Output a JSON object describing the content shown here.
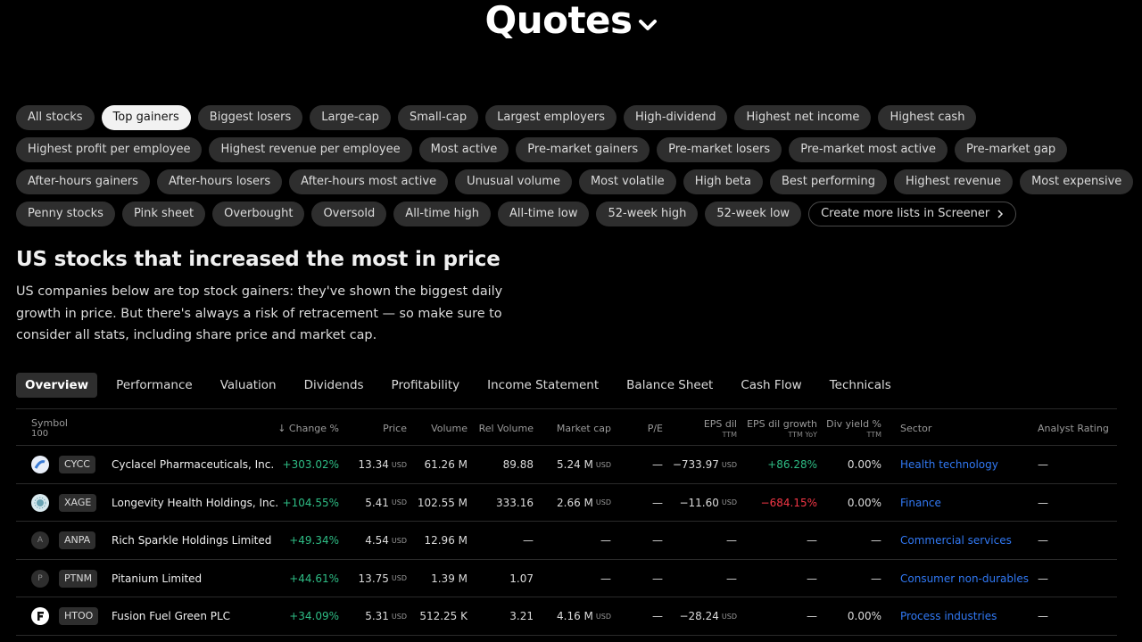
{
  "page": {
    "title": "Quotes",
    "heading": "US stocks that increased the most in price",
    "description": "US companies below are top stock gainers: they've shown the biggest daily growth in price. But there's always a risk of retracement — so make sure to consider all stats, including share price and market cap."
  },
  "lists": [
    [
      "All stocks",
      "Top gainers",
      "Biggest losers",
      "Large-cap",
      "Small-cap",
      "Largest employers",
      "High-dividend",
      "Highest net income",
      "Highest cash"
    ],
    [
      "Highest profit per employee",
      "Highest revenue per employee",
      "Most active",
      "Pre-market gainers",
      "Pre-market losers",
      "Pre-market most active",
      "Pre-market gap"
    ],
    [
      "After-hours gainers",
      "After-hours losers",
      "After-hours most active",
      "Unusual volume",
      "Most volatile",
      "High beta",
      "Best performing",
      "Highest revenue",
      "Most expensive"
    ],
    [
      "Penny stocks",
      "Pink sheet",
      "Overbought",
      "Oversold",
      "All-time high",
      "All-time low",
      "52-week high",
      "52-week low"
    ]
  ],
  "active_list": "Top gainers",
  "screener_link": "Create more lists in Screener",
  "tabs": [
    "Overview",
    "Performance",
    "Valuation",
    "Dividends",
    "Profitability",
    "Income Statement",
    "Balance Sheet",
    "Cash Flow",
    "Technicals"
  ],
  "active_tab": "Overview",
  "table": {
    "headers": {
      "symbol": "Symbol",
      "symbol_count": "100",
      "change": "↓ Change %",
      "price": "Price",
      "volume": "Volume",
      "rel_volume": "Rel Volume",
      "market_cap": "Market cap",
      "pe": "P/E",
      "eps": "EPS dil",
      "eps_sub": "TTM",
      "eps_growth": "EPS dil growth",
      "eps_growth_sub": "TTM YoY",
      "div_yield": "Div yield %",
      "div_yield_sub": "TTM",
      "sector": "Sector",
      "analyst": "Analyst Rating"
    },
    "currency": "USD",
    "rows": [
      {
        "logo": "cyclacel-logo-icon",
        "logo_letter": "",
        "ticker": "CYCC",
        "name": "Cyclacel Pharmaceuticals, Inc.",
        "change": "+303.02%",
        "price": "13.34",
        "volume": "61.26 M",
        "rel_volume": "89.88",
        "market_cap": "5.24 M",
        "pe": "—",
        "eps": "−733.97",
        "eps_growth": "+86.28%",
        "eps_growth_dir": "up",
        "div_yield": "0.00%",
        "sector": "Health technology",
        "analyst": "—"
      },
      {
        "logo": "longevity-logo-icon",
        "logo_letter": "",
        "ticker": "XAGE",
        "name": "Longevity Health Holdings, Inc.",
        "change": "+104.55%",
        "price": "5.41",
        "volume": "102.55 M",
        "rel_volume": "333.16",
        "market_cap": "2.66 M",
        "pe": "—",
        "eps": "−11.60",
        "eps_growth": "−684.15%",
        "eps_growth_dir": "down",
        "div_yield": "0.00%",
        "sector": "Finance",
        "analyst": "—"
      },
      {
        "logo": "letter-avatar-icon",
        "logo_letter": "A",
        "ticker": "ANPA",
        "name": "Rich Sparkle Holdings Limited",
        "change": "+49.34%",
        "price": "4.54",
        "volume": "12.96 M",
        "rel_volume": "—",
        "market_cap": "—",
        "pe": "—",
        "eps": "—",
        "eps_growth": "—",
        "eps_growth_dir": "none",
        "div_yield": "—",
        "sector": "Commercial services",
        "analyst": "—"
      },
      {
        "logo": "letter-avatar-icon",
        "logo_letter": "P",
        "ticker": "PTNM",
        "name": "Pitanium Limited",
        "change": "+44.61%",
        "price": "13.75",
        "volume": "1.39 M",
        "rel_volume": "1.07",
        "market_cap": "—",
        "pe": "—",
        "eps": "—",
        "eps_growth": "—",
        "eps_growth_dir": "none",
        "div_yield": "—",
        "sector": "Consumer non-durables",
        "analyst": "—"
      },
      {
        "logo": "fusion-fuel-logo-icon",
        "logo_letter": "",
        "ticker": "HTOO",
        "name": "Fusion Fuel Green PLC",
        "change": "+34.09%",
        "price": "5.31",
        "volume": "512.25 K",
        "rel_volume": "3.21",
        "market_cap": "4.16 M",
        "pe": "—",
        "eps": "−28.24",
        "eps_growth": "—",
        "eps_growth_dir": "none",
        "div_yield": "0.00%",
        "sector": "Process industries",
        "analyst": "—"
      }
    ]
  },
  "colors": {
    "positive": "#2ebd85",
    "negative": "#f23645",
    "link": "#3179f5"
  }
}
